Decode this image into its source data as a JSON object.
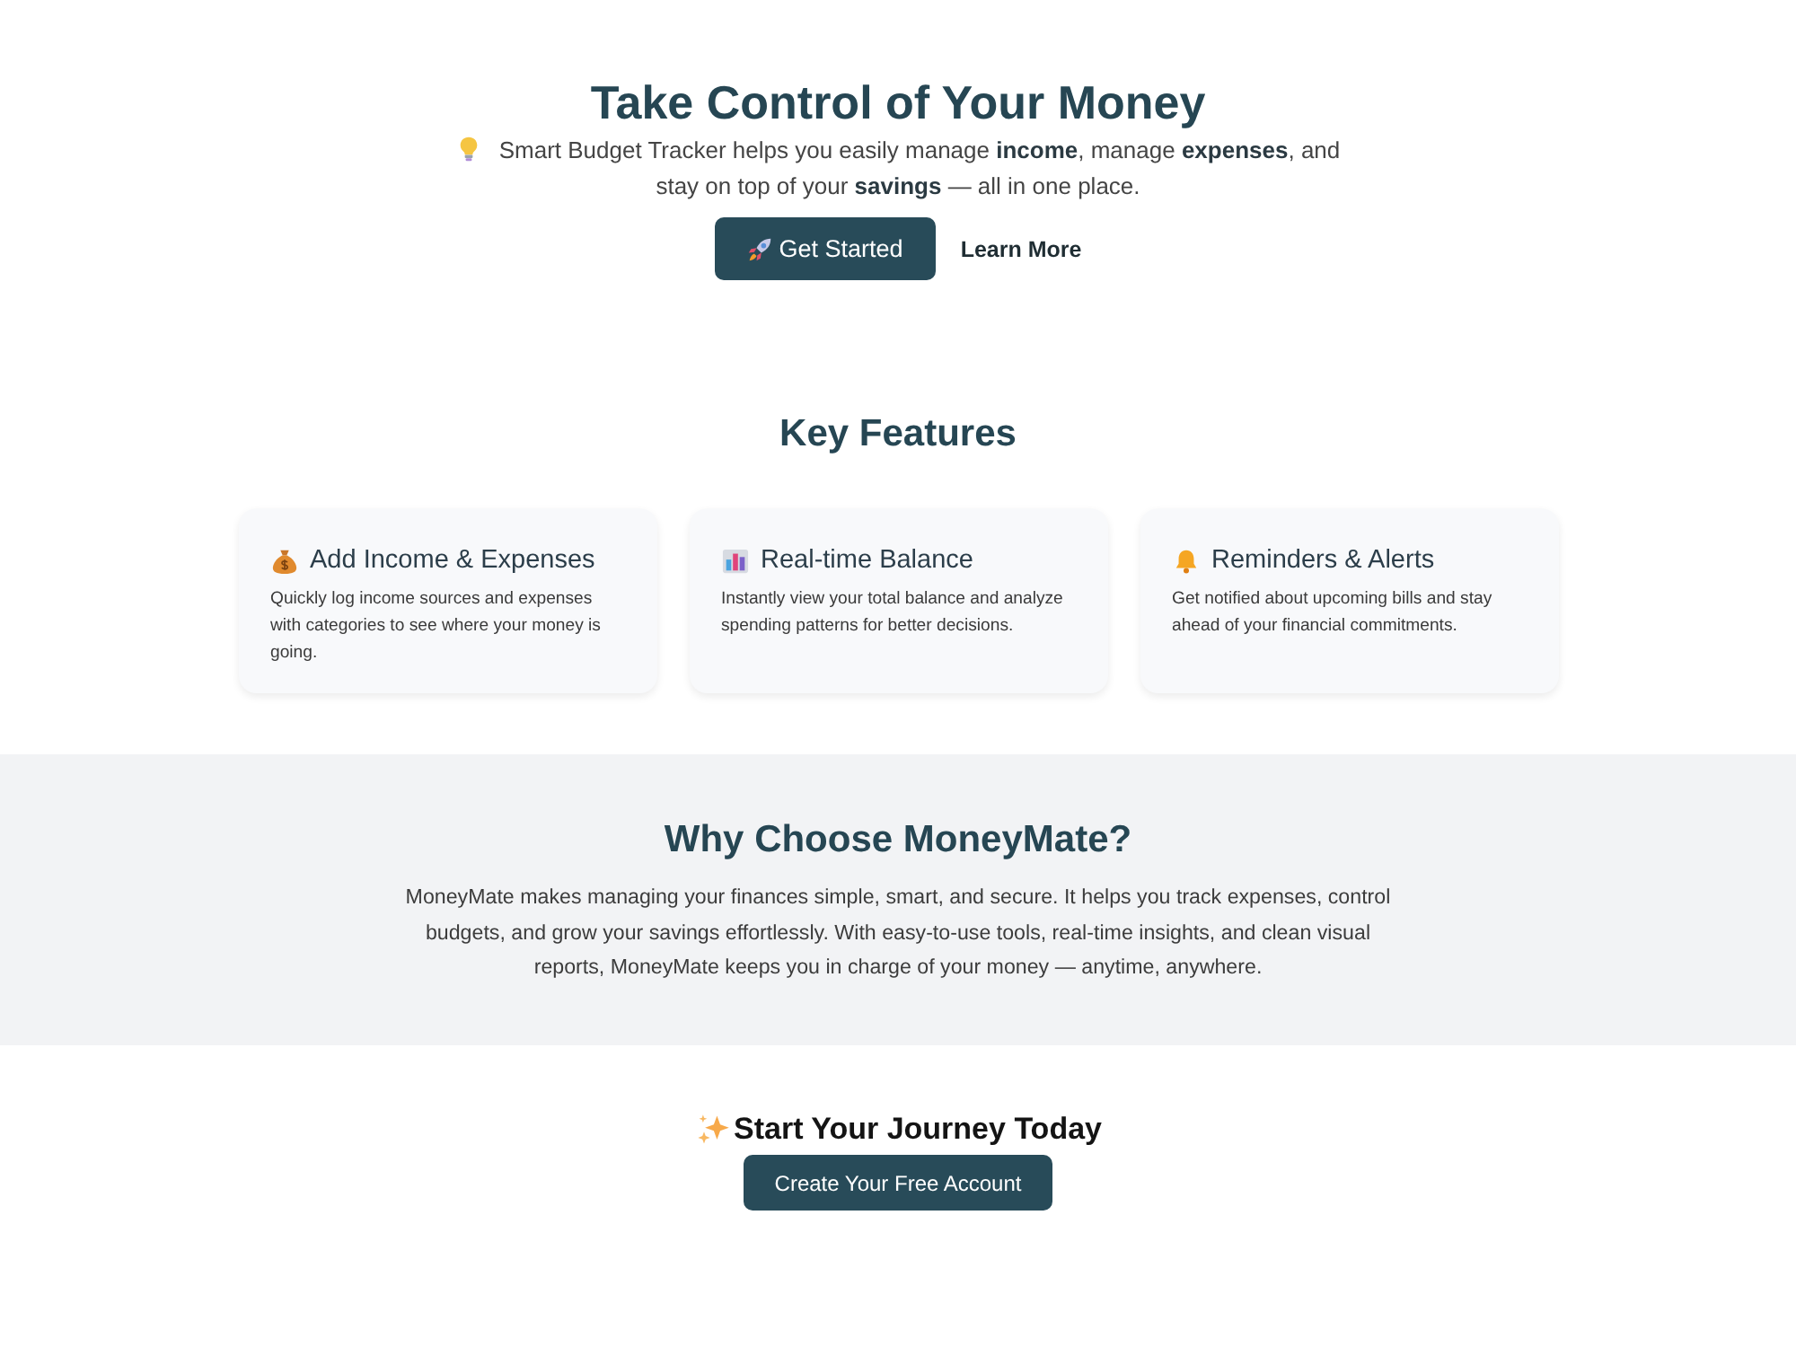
{
  "hero": {
    "title": "Take Control of Your Money",
    "subtitle": "Smart Budget Tracker helps you easily manage **income**, manage **expenses**, and stay on top of your **savings** — all in one place.",
    "actions": [
      {
        "label": "Get Started",
        "kind": "primary"
      },
      {
        "label": "Learn More",
        "kind": "link"
      }
    ]
  },
  "features": {
    "title": "Key Features",
    "cards": [
      {
        "title": "Add Income & Expenses",
        "description": "Quickly log income sources and expenses with categories to see where your money is going."
      },
      {
        "title": "Real-time Balance",
        "description": "Instantly view your total balance and analyze spending patterns for better decisions."
      },
      {
        "title": "Reminders & Alerts",
        "description": "Get notified about upcoming bills and stay ahead of your financial commitments."
      }
    ]
  },
  "why": {
    "title": "Why Choose MoneyMate?",
    "text": "MoneyMate makes managing your finances simple, smart, and secure. It helps you track expenses, control budgets, and grow your savings effortlessly. With easy-to-use tools, real-time insights, and clean visual reports, MoneyMate keeps you in charge of your money — anytime, anywhere."
  },
  "cta": {
    "title": "Start Your Journey Today",
    "button": "Create Your Free Account"
  }
}
